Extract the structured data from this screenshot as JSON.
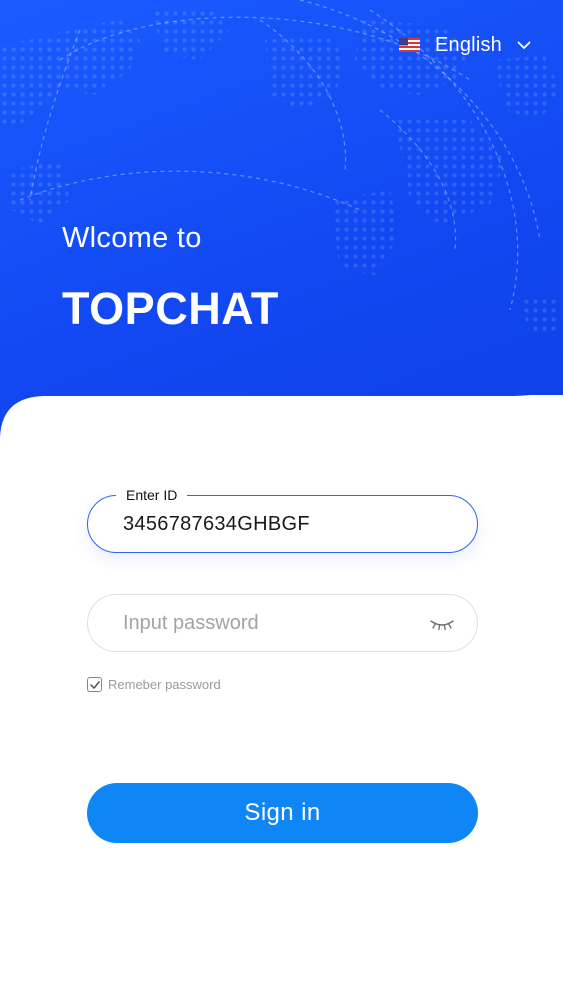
{
  "header": {
    "language_label": "English",
    "flag_icon": "us-flag-icon",
    "dropdown_icon": "chevron-down-icon"
  },
  "hero": {
    "welcome": "Wlcome to",
    "brand": "TOPCHAT"
  },
  "form": {
    "id_field": {
      "label": "Enter ID",
      "value": "3456787634GHBGF"
    },
    "password_field": {
      "placeholder": "Input password",
      "visibility_icon": "eye-closed-icon"
    },
    "remember": {
      "label": "Remeber password",
      "checked": true
    },
    "submit_label": "Sign in"
  },
  "colors": {
    "hero_blue": "#1248f2",
    "field_focus_border": "#2e62f5",
    "button_blue": "#0f86f5"
  }
}
